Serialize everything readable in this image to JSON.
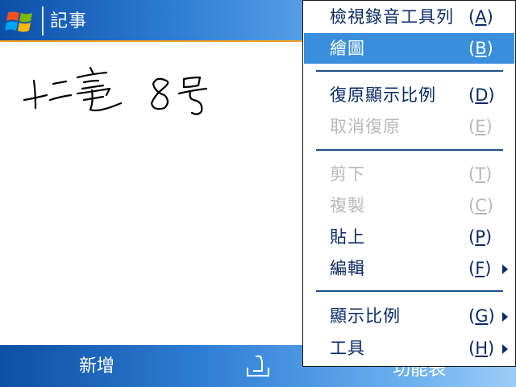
{
  "titlebar": {
    "start_icon": "windows-flag-icon",
    "title": "記事"
  },
  "note": {
    "ink": "handwritten-ink"
  },
  "softkeys": {
    "left": "新增",
    "input_icon": "input-panel-icon",
    "right": "功能表"
  },
  "menu": {
    "items": [
      {
        "label": "檢視錄音工具列",
        "key": "A",
        "selected": false,
        "enabled": true,
        "submenu": false
      },
      {
        "label": "繪圖",
        "key": "B",
        "selected": true,
        "enabled": true,
        "submenu": false
      },
      {
        "label": "復原顯示比例",
        "key": "D",
        "selected": false,
        "enabled": true,
        "submenu": false
      },
      {
        "label": "取消復原",
        "key": "E",
        "selected": false,
        "enabled": false,
        "submenu": false
      },
      {
        "label": "剪下",
        "key": "T",
        "selected": false,
        "enabled": false,
        "submenu": false
      },
      {
        "label": "複製",
        "key": "C",
        "selected": false,
        "enabled": false,
        "submenu": false
      },
      {
        "label": "貼上",
        "key": "P",
        "selected": false,
        "enabled": true,
        "submenu": false
      },
      {
        "label": "編輯",
        "key": "F",
        "selected": false,
        "enabled": true,
        "submenu": true
      },
      {
        "label": "顯示比例",
        "key": "G",
        "selected": false,
        "enabled": true,
        "submenu": true
      },
      {
        "label": "工具",
        "key": "H",
        "selected": false,
        "enabled": true,
        "submenu": true
      }
    ]
  }
}
